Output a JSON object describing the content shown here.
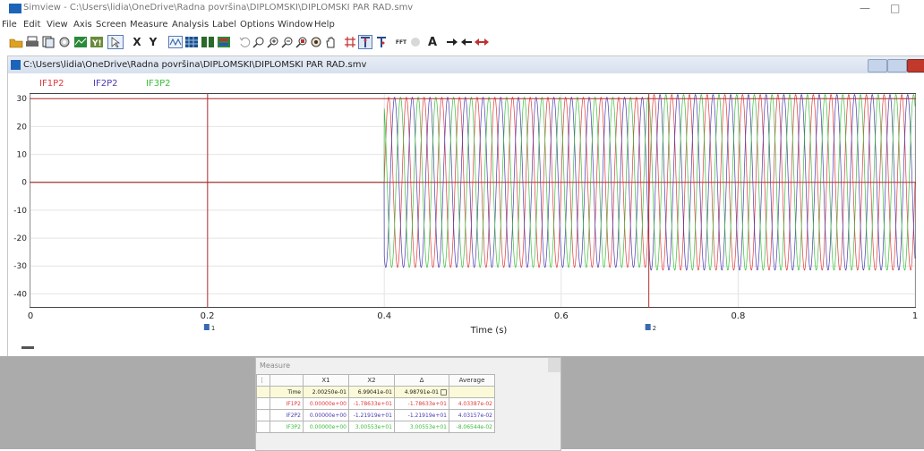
{
  "app": {
    "title": "Simview - C:\\Users\\lidia\\OneDrive\\Radna površina\\DIPLOMSKI\\DIPLOMSKI PAR RAD.smv",
    "minimize_glyph": "—",
    "maximize_glyph": "□"
  },
  "menu": [
    "File",
    "Edit",
    "View",
    "Axis",
    "Screen",
    "Measure",
    "Analysis",
    "Label",
    "Options",
    "Window",
    "Help"
  ],
  "toolbar": {
    "x_label": "X",
    "y_label": "Y",
    "fft_label": "FFT",
    "text_label": "A",
    "icons": [
      "open-icon",
      "print-icon",
      "copy-icon",
      "settings-icon",
      "chart-icon",
      "xy-icon",
      "cursor-icon",
      "x-axis-icon",
      "y-axis-icon",
      "waveform-icon",
      "grid-icon",
      "split-icon",
      "color-icon",
      "undo-icon",
      "zoom-icon",
      "zoom-in-icon",
      "zoom-out-icon",
      "zoom-fit-icon",
      "pan-icon",
      "hand-icon",
      "cursor-lock-icon",
      "cursor-t-icon",
      "cursor-t2-icon",
      "fft-icon",
      "toggle-icon",
      "text-icon",
      "arrow-right-icon",
      "arrow-left-icon",
      "arrow-both-icon"
    ]
  },
  "document": {
    "title": "C:\\Users\\lidia\\OneDrive\\Radna površina\\DIPLOMSKI\\DIPLOMSKI PAR RAD.smv"
  },
  "colors": {
    "IF1P2": "#e03a3a",
    "IF2P2": "#4a3ab0",
    "IF3P2": "#3abf3a",
    "cursor": "#b03030",
    "grid": "#e4e4e4"
  },
  "chart_data": {
    "type": "line",
    "xlabel": "Time (s)",
    "xlim": [
      0,
      1
    ],
    "ylim": [
      -45,
      32
    ],
    "x_ticks": [
      "0",
      "0.2",
      "0.4",
      "0.6",
      "0.8",
      "1"
    ],
    "y_ticks": [
      "30",
      "20",
      "10",
      "0",
      "-10",
      "-20",
      "-30",
      "-40"
    ],
    "legend": [
      "IF1P2",
      "IF2P2",
      "IF3P2"
    ],
    "legend_position": "top-left",
    "grid": true,
    "series": [
      {
        "name": "IF1P2",
        "frequency_hz": 50,
        "phase_deg": 0,
        "segments": [
          {
            "from": 0,
            "to": 0.4,
            "amplitude": 0
          },
          {
            "from": 0.4,
            "to": 0.7,
            "amplitude": 30.5
          },
          {
            "from": 0.7,
            "to": 1.0,
            "amplitude": 31.5
          }
        ]
      },
      {
        "name": "IF2P2",
        "frequency_hz": 50,
        "phase_deg": -120,
        "segments": [
          {
            "from": 0,
            "to": 0.4,
            "amplitude": 0
          },
          {
            "from": 0.4,
            "to": 0.7,
            "amplitude": 30.5
          },
          {
            "from": 0.7,
            "to": 1.0,
            "amplitude": 31.5
          }
        ]
      },
      {
        "name": "IF3P2",
        "frequency_hz": 50,
        "phase_deg": 120,
        "segments": [
          {
            "from": 0,
            "to": 0.4,
            "amplitude": 0
          },
          {
            "from": 0.4,
            "to": 0.7,
            "amplitude": 30.5
          },
          {
            "from": 0.7,
            "to": 1.0,
            "amplitude": 31.5
          }
        ]
      }
    ],
    "cursors": [
      {
        "label": "1",
        "x": 0.20025,
        "y": 0
      },
      {
        "label": "2",
        "x": 0.699041,
        "y": 30
      }
    ]
  },
  "measure": {
    "title": "Measure",
    "headers": [
      "X1",
      "X2",
      "Δ",
      "Average"
    ],
    "rows": [
      {
        "label": "Time",
        "x1": "2.00250e-01",
        "x2": "6.99041e-01",
        "delta": "4.98791e-01",
        "avg": ""
      },
      {
        "label": "IF1P2",
        "x1": "0.00000e+00",
        "x2": "-1.78633e+01",
        "delta": "-1.78633e+01",
        "avg": "4.03387e-02"
      },
      {
        "label": "IF2P2",
        "x1": "0.00000e+00",
        "x2": "-1.21919e+01",
        "delta": "-1.21919e+01",
        "avg": "4.03157e-02"
      },
      {
        "label": "IF3P2",
        "x1": "0.00000e+00",
        "x2": "3.00553e+01",
        "delta": "3.00553e+01",
        "avg": "-8.06544e-02"
      }
    ]
  }
}
